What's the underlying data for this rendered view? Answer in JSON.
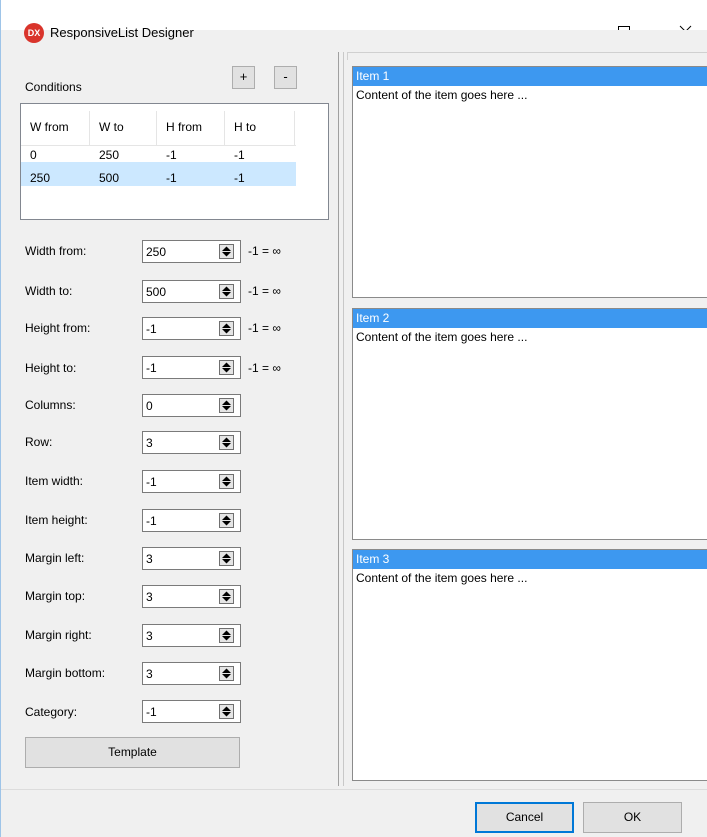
{
  "window": {
    "title": "ResponsiveList Designer",
    "logo_text": "DX",
    "controls": {
      "minimize": "minimize",
      "maximize": "maximize",
      "close": "close"
    }
  },
  "conditions": {
    "label": "Conditions",
    "add_label": "+",
    "remove_label": "-",
    "columns": [
      "W from",
      "W to",
      "H from",
      "H to"
    ],
    "rows": [
      [
        "0",
        "250",
        "-1",
        "-1"
      ],
      [
        "250",
        "500",
        "-1",
        "-1"
      ]
    ],
    "selected_row": 1
  },
  "fields": [
    {
      "label": "Width from:",
      "value": "250",
      "hint": "-1 = ∞"
    },
    {
      "label": "Width to:",
      "value": "500",
      "hint": "-1 = ∞"
    },
    {
      "label": "Height from:",
      "value": "-1",
      "hint": "-1 = ∞"
    },
    {
      "label": "Height to:",
      "value": "-1",
      "hint": "-1 = ∞"
    },
    {
      "label": "Columns:",
      "value": "0"
    },
    {
      "label": "Row:",
      "value": "3"
    },
    {
      "label": "Item width:",
      "value": "-1"
    },
    {
      "label": "Item height:",
      "value": "-1"
    },
    {
      "label": "Margin left:",
      "value": "3"
    },
    {
      "label": "Margin top:",
      "value": "3"
    },
    {
      "label": "Margin right:",
      "value": "3"
    },
    {
      "label": "Margin bottom:",
      "value": "3"
    },
    {
      "label": "Category:",
      "value": "-1"
    }
  ],
  "template_button": "Template",
  "preview": {
    "items": [
      {
        "title": "Item 1",
        "content": "Content of the item goes here ..."
      },
      {
        "title": "Item 2",
        "content": "Content of the item goes here ..."
      },
      {
        "title": "Item 3",
        "content": "Content of the item goes here ..."
      }
    ]
  },
  "footer": {
    "cancel": "Cancel",
    "ok": "OK"
  },
  "colors": {
    "accent": "#3d98f0",
    "selection": "#cce8ff",
    "logo": "#d9342b",
    "default_border": "#0078d7"
  }
}
